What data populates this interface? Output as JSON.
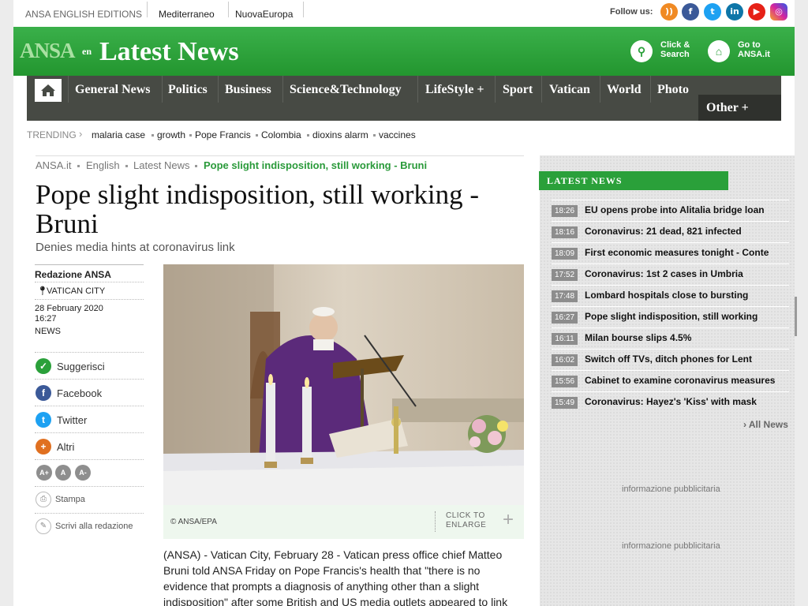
{
  "topbar": {
    "editions": "ANSA ENGLISH EDITIONS",
    "links": [
      "Mediterraneo",
      "NuovaEuropa"
    ],
    "follow": "Follow us:"
  },
  "header": {
    "logo": "ANSA",
    "logo_suffix": "en",
    "title": "Latest News",
    "search_label_1": "Click &",
    "search_label_2": "Search",
    "goto_label_1": "Go to",
    "goto_label_2": "ANSA.it"
  },
  "nav": {
    "items": [
      "General News",
      "Politics",
      "Business",
      "Science&Technology",
      "LifeStyle +",
      "Sport",
      "Vatican",
      "World",
      "Photo"
    ],
    "other": "Other +"
  },
  "trending": {
    "label": "TRENDING",
    "items": [
      "malaria case",
      "growth",
      "Pope Francis",
      "Colombia",
      "dioxins alarm",
      "vaccines"
    ]
  },
  "breadcrumb": [
    "ANSA.it",
    "English",
    "Latest News",
    "Pope slight indisposition, still working - Bruni"
  ],
  "article": {
    "headline": "Pope slight indisposition, still working - Bruni",
    "subtitle": "Denies media hints at coronavirus link",
    "author": "Redazione ANSA",
    "location": "VATICAN CITY",
    "date": "28 February 2020",
    "time": "16:27",
    "category": "NEWS",
    "photo_credit": "© ANSA/EPA",
    "enlarge_1": "CLICK TO",
    "enlarge_2": "ENLARGE",
    "body": "(ANSA) - Vatican City, February 28 - Vatican press office chief Matteo Bruni told ANSA Friday on Pope Francis's health that \"there is no evidence that prompts a diagnosis of anything other than a slight indisposition\" after some British and US media outlets appeared to link"
  },
  "share": {
    "suggest": "Suggerisci",
    "facebook": "Facebook",
    "twitter": "Twitter",
    "altri": "Altri",
    "font_up": "A+",
    "font_reset": "A",
    "font_down": "A-",
    "print": "Stampa",
    "write": "Scrivi alla redazione"
  },
  "sidebar": {
    "heading": "LATEST NEWS",
    "news": [
      {
        "time": "18:26",
        "title": "EU opens probe into Alitalia bridge loan"
      },
      {
        "time": "18:16",
        "title": "Coronavirus: 21 dead, 821 infected"
      },
      {
        "time": "18:09",
        "title": "First economic measures tonight - Conte"
      },
      {
        "time": "17:52",
        "title": "Coronavirus: 1st 2 cases in Umbria"
      },
      {
        "time": "17:48",
        "title": "Lombard hospitals close to bursting"
      },
      {
        "time": "16:27",
        "title": "Pope slight indisposition, still working"
      },
      {
        "time": "16:11",
        "title": "Milan bourse slips 4.5%"
      },
      {
        "time": "16:02",
        "title": "Switch off TVs, ditch phones for Lent"
      },
      {
        "time": "15:56",
        "title": "Cabinet to examine coronavirus measures"
      },
      {
        "time": "15:49",
        "title": "Coronavirus: Hayez's 'Kiss' with mask"
      }
    ],
    "all_news": "› All News",
    "ad_1": "informazione pubblicitaria",
    "ad_2": "informazione pubblicitaria"
  },
  "colors": {
    "brand_green": "#2aa03a",
    "nav_bg": "#474a44",
    "time_badge": "#8d8d8d"
  }
}
